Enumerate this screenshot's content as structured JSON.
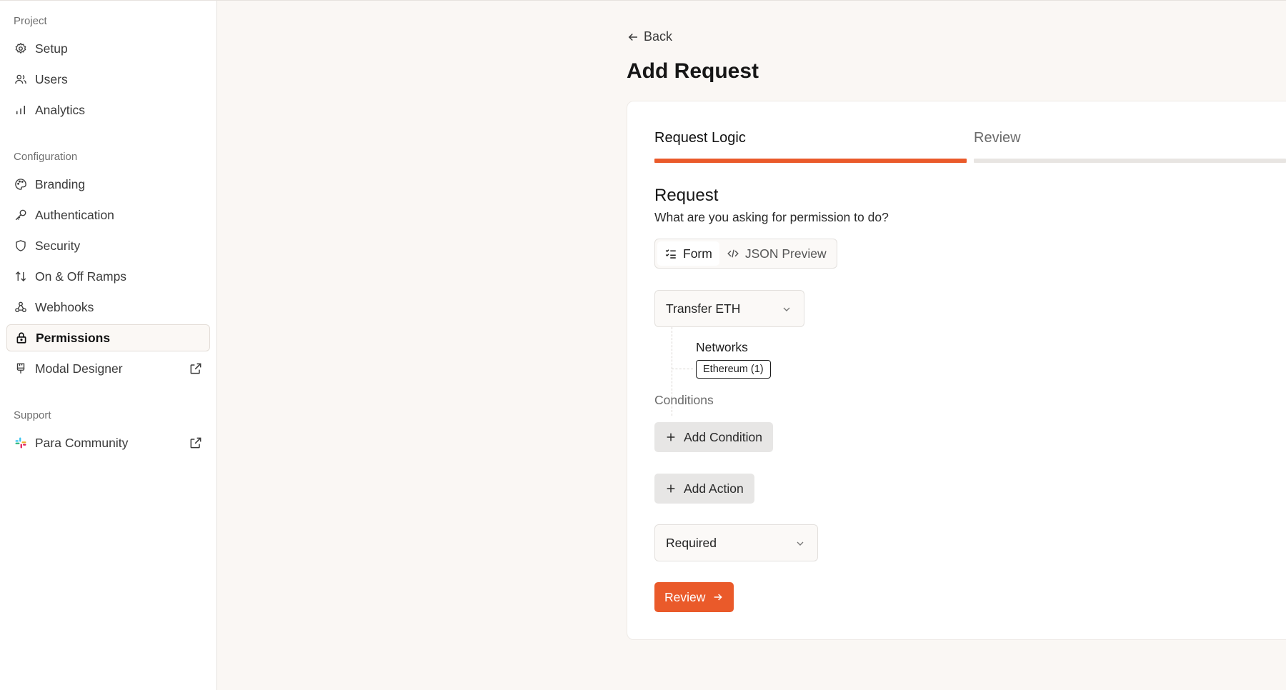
{
  "colors": {
    "accent": "#ea5a2a",
    "track": "#e8e5e2",
    "background": "#faf7f4"
  },
  "sidebar": {
    "sections": [
      {
        "label": "Project",
        "items": [
          {
            "label": "Setup",
            "icon": "gear-icon"
          },
          {
            "label": "Users",
            "icon": "users-icon"
          },
          {
            "label": "Analytics",
            "icon": "bar-chart-icon"
          }
        ]
      },
      {
        "label": "Configuration",
        "items": [
          {
            "label": "Branding",
            "icon": "palette-icon"
          },
          {
            "label": "Authentication",
            "icon": "key-icon"
          },
          {
            "label": "Security",
            "icon": "shield-icon"
          },
          {
            "label": "On & Off Ramps",
            "icon": "arrows-up-down-icon"
          },
          {
            "label": "Webhooks",
            "icon": "webhook-icon"
          },
          {
            "label": "Permissions",
            "icon": "lock-icon",
            "active": true
          },
          {
            "label": "Modal Designer",
            "icon": "brush-icon",
            "external": true
          }
        ]
      },
      {
        "label": "Support",
        "items": [
          {
            "label": "Para Community",
            "icon": "slack-icon",
            "external": true
          }
        ]
      }
    ]
  },
  "main": {
    "back_label": "Back",
    "title": "Add Request",
    "steps": [
      {
        "label": "Request Logic",
        "active": true
      },
      {
        "label": "Review",
        "active": false
      }
    ],
    "request_title": "Request",
    "request_subtitle": "What are you asking for permission to do?",
    "view_toggle": {
      "form": "Form",
      "json": "JSON Preview",
      "selected": "Form"
    },
    "action_select": "Transfer ETH",
    "networks_label": "Networks",
    "network_chip": "Ethereum (1)",
    "conditions_label": "Conditions",
    "add_condition": "Add Condition",
    "add_action": "Add Action",
    "requirement_select": "Required",
    "review_button": "Review"
  }
}
